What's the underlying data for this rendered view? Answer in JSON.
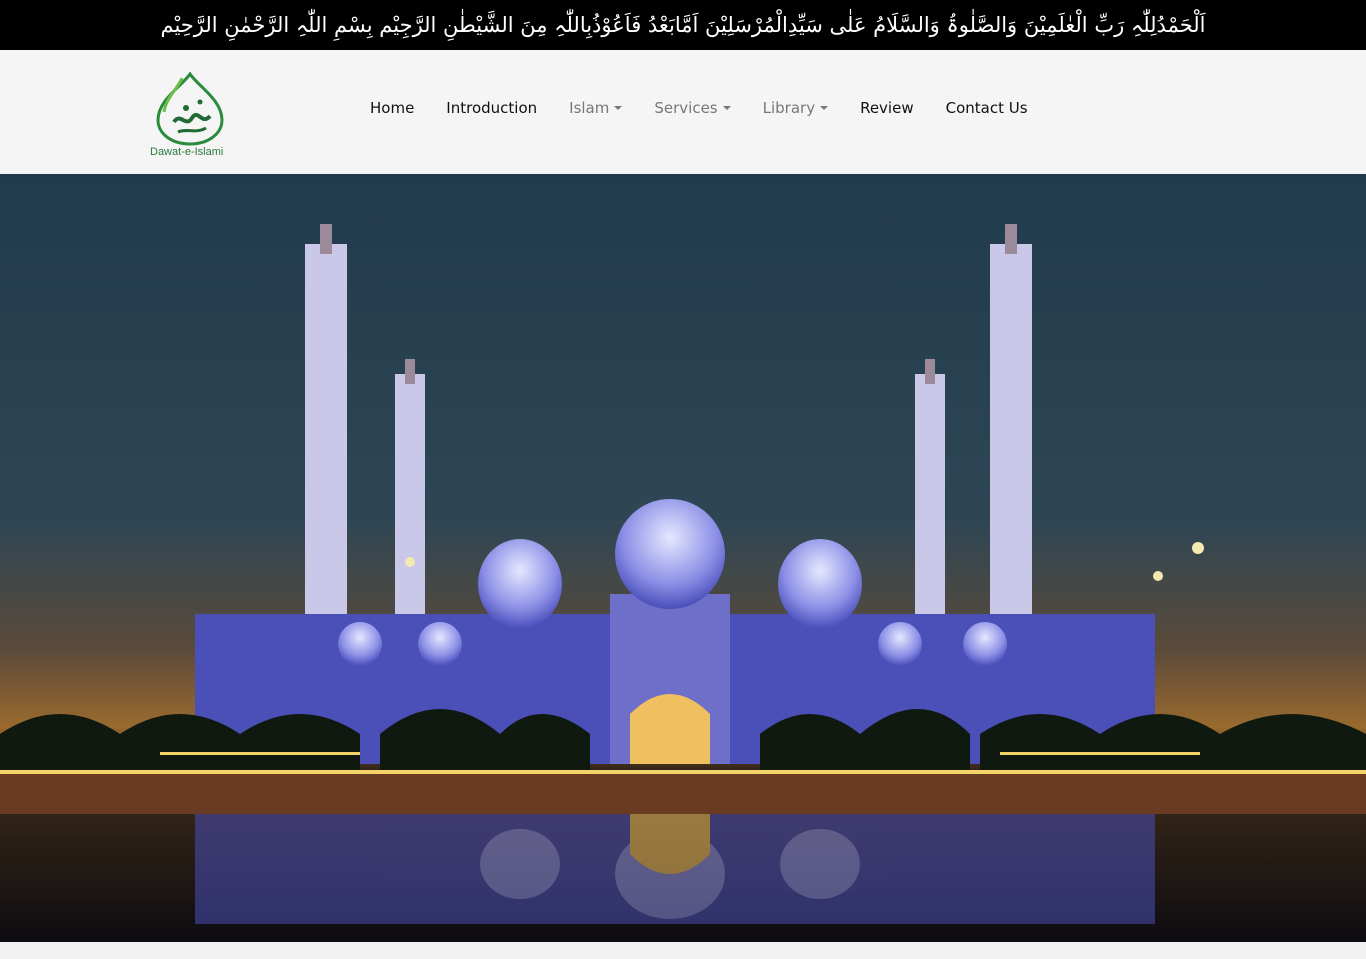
{
  "top_banner": {
    "text": "اَلْحَمْدُلِلّٰہِ رَبِّ الْعٰلَمِیْنَ وَالصَّلٰوۃُ وَالسَّلَامُ عَلٰی سَیِّدِالْمُرْسَلِیْنَ اَمَّابَعْدُ فَاَعُوْذُبِاللّٰہِ مِنَ الشَّیْطٰنِ الرَّجِیْم بِسْمِ اللّٰہِ الرَّحْمٰنِ الرَّحِیْم"
  },
  "logo": {
    "text": "Dawat-e-Islami",
    "color": "#2b7a3b"
  },
  "nav": {
    "home": "Home",
    "introduction": "Introduction",
    "islam": "Islam",
    "services": "Services",
    "library": "Library",
    "review": "Review",
    "contact": "Contact Us"
  },
  "colors": {
    "banner_bg": "#000000",
    "navbar_bg": "#f5f5f5",
    "active_text": "#111111",
    "muted_text": "#777777"
  }
}
